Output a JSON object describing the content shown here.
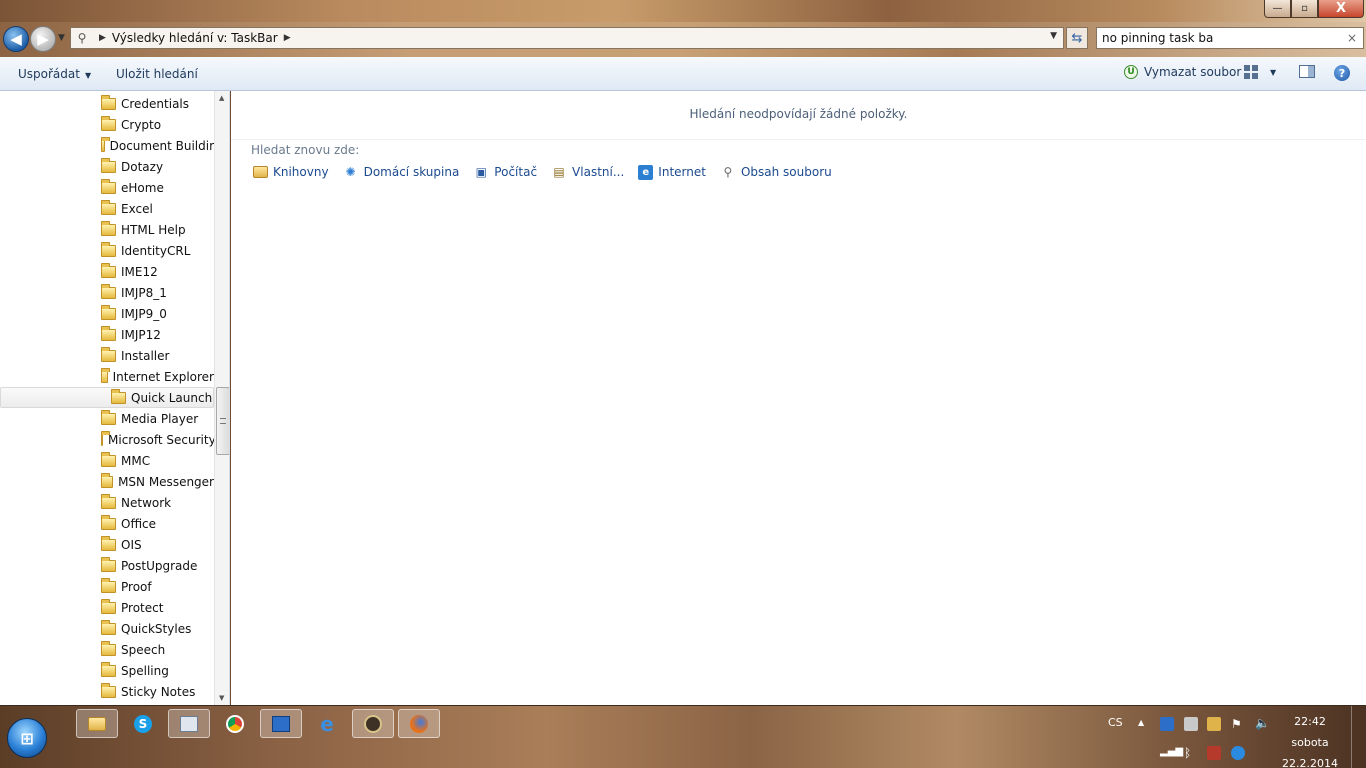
{
  "window": {
    "controls": {
      "minimize": "—",
      "maximize": "▫",
      "close": "X"
    }
  },
  "navigation": {
    "back_icon": "back-arrow-icon",
    "forward_icon": "forward-arrow-icon",
    "path_label": "Výsledky hledání v: TaskBar",
    "search_value": "no pinning task ba",
    "clear_symbol": "×",
    "refresh_symbol": "⇆"
  },
  "toolbar": {
    "organize_label": "Uspořádat",
    "save_search_label": "Uložit hledání",
    "delete_file_label": "Vymazat soubor",
    "delete_file_badge": "U"
  },
  "tree": {
    "items": [
      {
        "label": "Credentials"
      },
      {
        "label": "Crypto"
      },
      {
        "label": "Document Buildir"
      },
      {
        "label": "Dotazy"
      },
      {
        "label": "eHome"
      },
      {
        "label": "Excel"
      },
      {
        "label": "HTML Help"
      },
      {
        "label": "IdentityCRL"
      },
      {
        "label": "IME12"
      },
      {
        "label": "IMJP8_1"
      },
      {
        "label": "IMJP9_0"
      },
      {
        "label": "IMJP12"
      },
      {
        "label": "Installer"
      },
      {
        "label": "Internet Explorer"
      },
      {
        "label": "Quick Launch",
        "selected": true
      },
      {
        "label": "Media Player"
      },
      {
        "label": "Microsoft Security"
      },
      {
        "label": "MMC"
      },
      {
        "label": "MSN Messenger"
      },
      {
        "label": "Network"
      },
      {
        "label": "Office"
      },
      {
        "label": "OIS"
      },
      {
        "label": "PostUpgrade"
      },
      {
        "label": "Proof"
      },
      {
        "label": "Protect"
      },
      {
        "label": "QuickStyles"
      },
      {
        "label": "Speech"
      },
      {
        "label": "Spelling"
      },
      {
        "label": "Sticky Notes"
      }
    ]
  },
  "content": {
    "no_results": "Hledání neodpovídají žádné položky.",
    "search_again_title": "Hledat znovu zde:",
    "search_again": [
      {
        "label": "Knihovny",
        "icon": "libraries-icon"
      },
      {
        "label": "Domácí skupina",
        "icon": "homegroup-icon"
      },
      {
        "label": "Počítač",
        "icon": "computer-icon"
      },
      {
        "label": "Vlastní...",
        "icon": "custom-icon"
      },
      {
        "label": "Internet",
        "icon": "internet-icon"
      },
      {
        "label": "Obsah souboru",
        "icon": "file-contents-icon"
      }
    ]
  },
  "taskbar": {
    "start_symbol": "⊞",
    "language": "CS",
    "time": "22:42",
    "weekday": "sobota",
    "date": "22.2.2014"
  }
}
